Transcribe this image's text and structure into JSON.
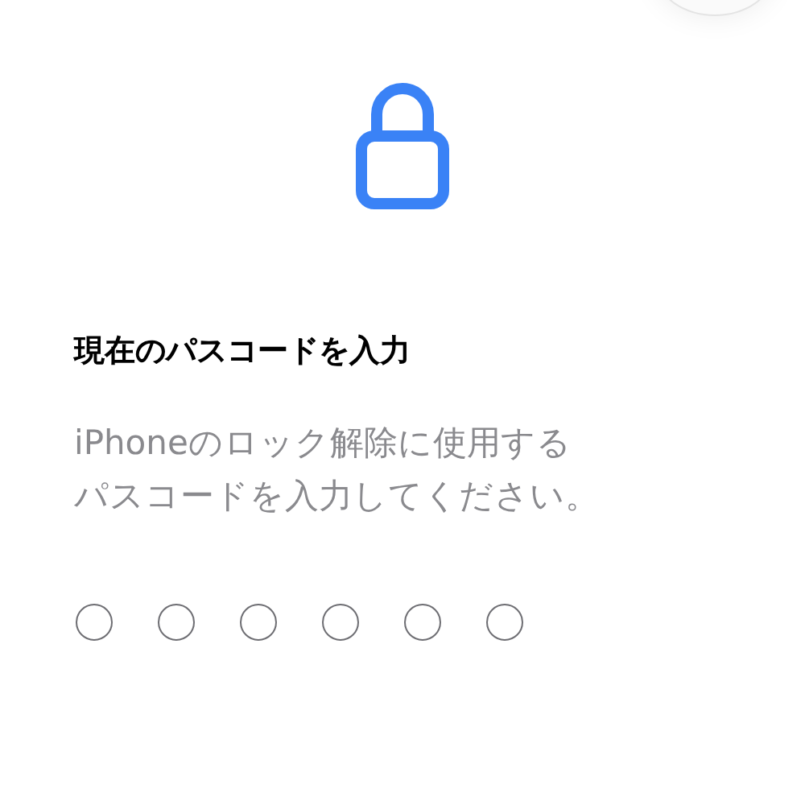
{
  "title": "現在のパスコードを入力",
  "description": "iPhoneのロック解除に使用するパスコードを入力してください。",
  "passcode_dots": [
    {
      "filled": false
    },
    {
      "filled": false
    },
    {
      "filled": false
    },
    {
      "filled": false
    },
    {
      "filled": false
    },
    {
      "filled": false
    }
  ]
}
